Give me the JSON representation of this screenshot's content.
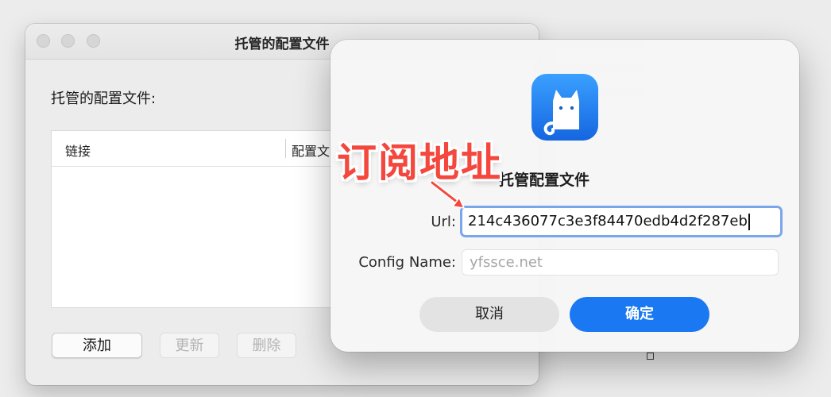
{
  "background_window": {
    "title": "托管的配置文件",
    "section_label": "托管的配置文件:",
    "table_columns": [
      "链接",
      "配置文"
    ],
    "buttons": {
      "add": "添加",
      "update": "更新",
      "delete": "删除"
    }
  },
  "dialog": {
    "title_visible": "托管配置文件",
    "url_label": "Url:",
    "url_value": "214c436077c3e3f84470edb4d2f287eb",
    "config_name_label": "Config Name:",
    "config_name_placeholder": "yfssce.net",
    "cancel_label": "取消",
    "ok_label": "确定"
  },
  "annotation": {
    "text": "订阅地址",
    "color": "#f4473d"
  },
  "colors": {
    "accent": "#1a78f2",
    "focus_ring": "#7aa6ea",
    "icon_bg": "#2b8cf5"
  }
}
